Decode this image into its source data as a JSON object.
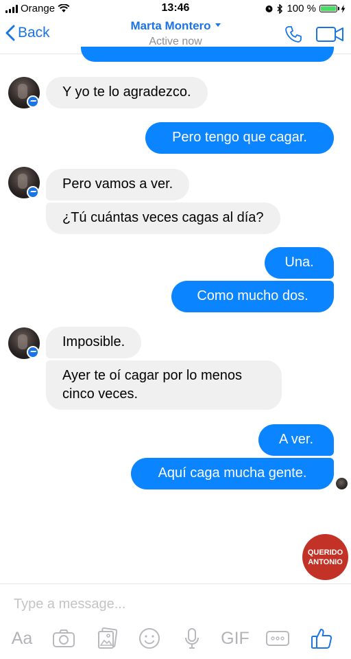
{
  "status_bar": {
    "carrier": "Orange",
    "time": "13:46",
    "battery": "100 %",
    "battery_level": 1.0
  },
  "header": {
    "back_label": "Back",
    "contact_name": "Marta Montero",
    "contact_status": "Active now"
  },
  "messages": [
    {
      "from": "them",
      "text": "Y yo te lo agradezco."
    },
    {
      "from": "me",
      "text": "Pero tengo que cagar."
    },
    {
      "from": "them",
      "text": "Pero vamos a ver."
    },
    {
      "from": "them",
      "text": "¿Tú cuántas veces cagas al día?"
    },
    {
      "from": "me",
      "text": "Una."
    },
    {
      "from": "me",
      "text": "Como mucho dos."
    },
    {
      "from": "them",
      "text": "Imposible."
    },
    {
      "from": "them",
      "text": "Ayer te oí cagar por lo menos\ncinco veces."
    },
    {
      "from": "me",
      "text": "A ver."
    },
    {
      "from": "me",
      "text": "Aquí caga mucha gente."
    }
  ],
  "watermark": {
    "line1": "QUERIDO",
    "line2": "ANTONIO"
  },
  "composer": {
    "placeholder": "Type a message...",
    "value": ""
  },
  "toolbar": {
    "text_format_label": "Aa",
    "gif_label": "GIF"
  },
  "icons": {
    "wifi": "wifi-icon",
    "alarm": "alarm-icon",
    "bluetooth": "bluetooth-icon",
    "phone": "phone-icon",
    "video": "video-camera-icon",
    "camera": "camera-icon",
    "gallery": "gallery-icon",
    "emoji": "emoji-icon",
    "mic": "microphone-icon",
    "more": "more-icon",
    "like": "thumbs-up-icon"
  },
  "colors": {
    "accent": "#1b74e4",
    "outgoing_bubble": "#0b84ff",
    "incoming_bubble": "#f1f0f0",
    "watermark": "#c23226"
  }
}
